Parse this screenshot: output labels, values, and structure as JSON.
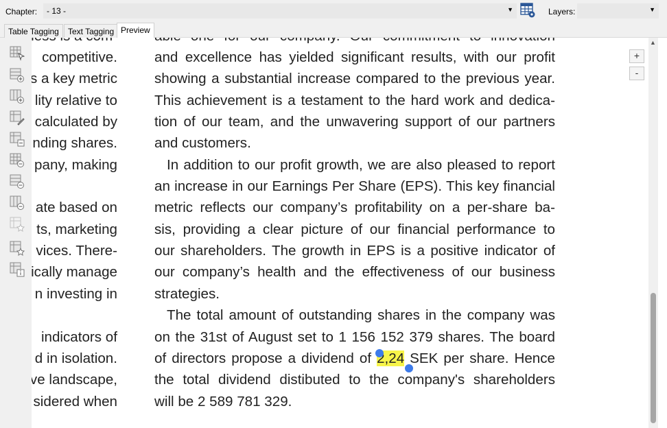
{
  "toolbar": {
    "chapter_label": "Chapter:",
    "chapter_value": "- 13 -",
    "layers_label": "Layers:",
    "layers_value": ""
  },
  "tabs": [
    {
      "label": "Table Tagging"
    },
    {
      "label": "Text Tagging"
    },
    {
      "label": "Preview"
    }
  ],
  "active_tab": "Preview",
  "left_column_lines": [
    "ness is a com-",
    "competitive.",
    "s a key metric",
    "lity relative to",
    "calculated by",
    "nding shares.",
    "pany, making",
    "",
    "ate based on",
    "ts, marketing",
    "vices. There-",
    "ically manage",
    "n investing in",
    "",
    "indicators of",
    "d in isolation.",
    "ve landscape,",
    "sidered when"
  ],
  "main_lines": [
    "able one for our company. Our commitment to innovation",
    "and excellence has yielded significant results, with our profit",
    "showing a substantial increase compared to the previous year.",
    "This achievement is a testament to the hard work and dedica-",
    "tion of our team, and the unwavering support of our partners",
    "and customers.",
    "In addition to our profit growth, we are also pleased to report",
    "an increase in our Earnings Per Share (EPS). This key financial",
    "metric reflects our company’s profitability on a per-share ba-",
    "sis, providing a clear picture of our financial performance to",
    "our shareholders. The growth in EPS is a positive indicator of",
    "our company’s health and the effectiveness of our business",
    "strategies.",
    "The total amount of outstanding shares in the company was",
    "on the 31st of August set to 1 156 152 379 shares. The board",
    "the total dividend distibuted to the company's shareholders",
    "will be 2 589 781 329."
  ],
  "dividend_line": {
    "before": "of directors propose a dividend of ",
    "highlight": "2,24",
    "after": " SEK per share. Hence"
  },
  "zoom": {
    "plus": "+",
    "minus": "-"
  },
  "colors": {
    "highlight": "#f7f44a",
    "selection_handle": "#3d7bea"
  }
}
